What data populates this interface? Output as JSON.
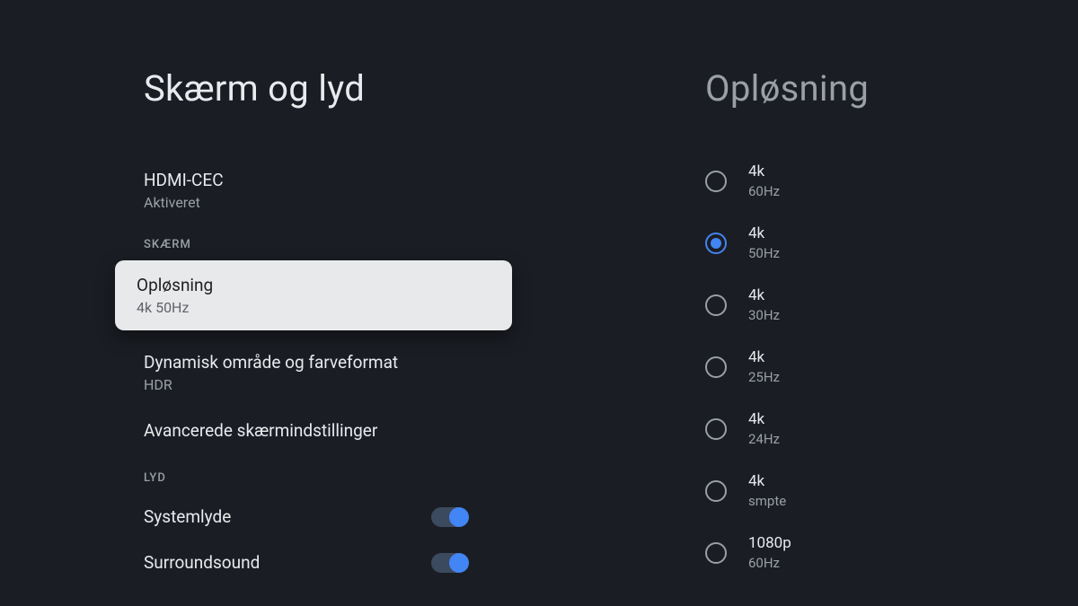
{
  "left": {
    "title": "Skærm og lyd",
    "hdmi_cec": {
      "title": "HDMI-CEC",
      "subtitle": "Aktiveret"
    },
    "section_screen": "SKÆRM",
    "resolution": {
      "title": "Opløsning",
      "subtitle": "4k 50Hz"
    },
    "dynamic_range": {
      "title": "Dynamisk område og farveformat",
      "subtitle": "HDR"
    },
    "advanced": {
      "title": "Avancerede skærmindstillinger"
    },
    "section_audio": "LYD",
    "system_sounds": {
      "title": "Systemlyde"
    },
    "surround": {
      "title": "Surroundsound"
    }
  },
  "right": {
    "title": "Opløsning",
    "options": [
      {
        "title": "4k",
        "subtitle": "60Hz",
        "selected": false
      },
      {
        "title": "4k",
        "subtitle": "50Hz",
        "selected": true
      },
      {
        "title": "4k",
        "subtitle": "30Hz",
        "selected": false
      },
      {
        "title": "4k",
        "subtitle": "25Hz",
        "selected": false
      },
      {
        "title": "4k",
        "subtitle": "24Hz",
        "selected": false
      },
      {
        "title": "4k",
        "subtitle": "smpte",
        "selected": false
      },
      {
        "title": "1080p",
        "subtitle": "60Hz",
        "selected": false
      }
    ]
  }
}
